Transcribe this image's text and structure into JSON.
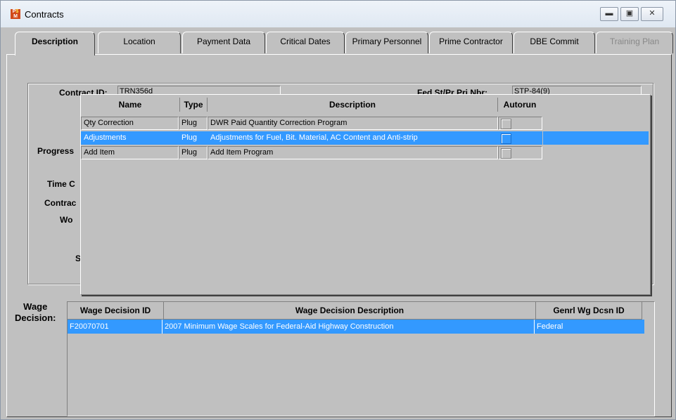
{
  "window": {
    "title": "Contracts",
    "icon": "psm-app-icon"
  },
  "tabs": [
    {
      "label": "Description",
      "state": "active"
    },
    {
      "label": "Location",
      "state": "normal"
    },
    {
      "label": "Payment Data",
      "state": "normal"
    },
    {
      "label": "Critical Dates",
      "state": "normal"
    },
    {
      "label": "Primary Personnel",
      "state": "normal"
    },
    {
      "label": "Prime Contractor",
      "state": "normal"
    },
    {
      "label": "DBE Commit",
      "state": "normal"
    },
    {
      "label": "Training Plan",
      "state": "disabled"
    }
  ],
  "form": {
    "contract_id_label": "Contract ID:",
    "contract_id_value": "TRN356d",
    "fed_label": "Fed St/Pr Pri Nbr:",
    "fed_value": "STP-84(9)",
    "progress_label": "Progress",
    "time_label": "Time C",
    "contract_label": "Contrac",
    "work_label": "Wo",
    "s_label": "S"
  },
  "popup": {
    "columns": [
      "Name",
      "Type",
      "Description",
      "Autorun"
    ],
    "rows": [
      {
        "name": "Qty Correction",
        "type": "Plug",
        "description": "DWR Paid Quantity Correction Program",
        "autorun": false,
        "selected": false
      },
      {
        "name": "Adjustments",
        "type": "Plug",
        "description": "Adjustments for Fuel, Bit. Material, AC Content and Anti-strip",
        "autorun": false,
        "selected": true
      },
      {
        "name": "Add Item",
        "type": "Plug",
        "description": "Add Item Program",
        "autorun": false,
        "selected": false
      }
    ]
  },
  "wage": {
    "label_line1": "Wage",
    "label_line2": "Decision:",
    "columns": [
      "Wage Decision ID",
      "Wage Decision Description",
      "Genrl Wg Dcsn ID"
    ],
    "rows": [
      {
        "id": "F20070701",
        "description": "2007 Minimum Wage Scales for Federal-Aid Highway Construction",
        "general": "Federal"
      }
    ]
  },
  "colors": {
    "selection": "#3399ff",
    "face": "#c0c0c0"
  }
}
